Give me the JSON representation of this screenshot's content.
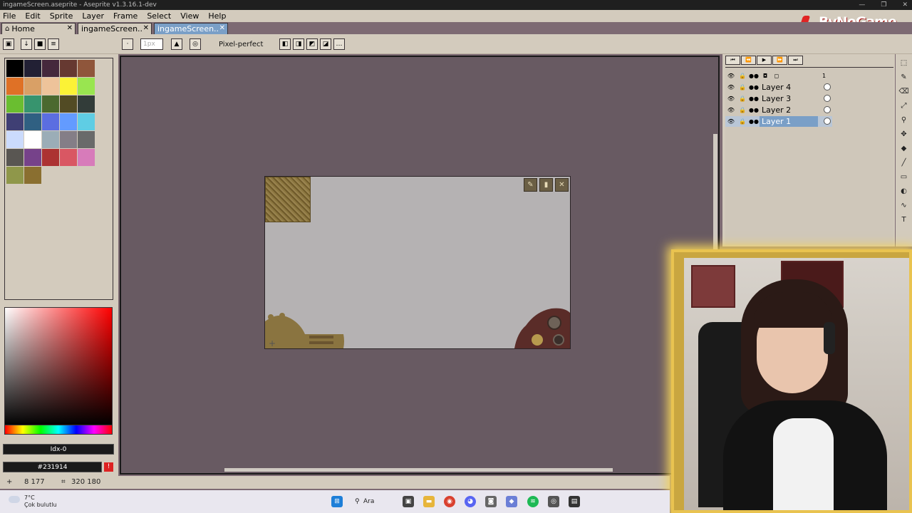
{
  "window": {
    "title": "ingameScreen.aseprite - Aseprite v1.3.16.1-dev",
    "minimize": "—",
    "maximize": "❐",
    "close": "✕"
  },
  "menu": [
    "File",
    "Edit",
    "Sprite",
    "Layer",
    "Frame",
    "Select",
    "View",
    "Help"
  ],
  "tabs": [
    {
      "label": "Home",
      "icon": "home-icon"
    },
    {
      "label": "ingameScreen..",
      "close": "✕"
    },
    {
      "label": "ingameScreen..",
      "close": "✕",
      "active": true
    }
  ],
  "brand": {
    "text": "ByNoGame"
  },
  "toolbar": {
    "brush_size": "1px",
    "pixel_perfect": "Pixel-perfect"
  },
  "palette": {
    "colors": [
      "#000000",
      "#222034",
      "#45283c",
      "#663931",
      "#8f563b",
      "#df7126",
      "#d9a066",
      "#eec39a",
      "#fbf236",
      "#99e550",
      "#6abe30",
      "#37946e",
      "#4b692f",
      "#524b24",
      "#323c39",
      "#3f3f74",
      "#306082",
      "#5b6ee1",
      "#639bff",
      "#5fcde4",
      "#cbdbfc",
      "#ffffff",
      "#9badb7",
      "#847e87",
      "#696a6a",
      "#595652",
      "#76428a",
      "#ac3232",
      "#d95763",
      "#d77bba",
      "#8f974a",
      "#8a6f30"
    ]
  },
  "color": {
    "index": "Idx-0",
    "hex": "#231914",
    "warn": "!"
  },
  "status": {
    "cursor": "8 177",
    "size": "320 180"
  },
  "animation": {
    "buttons": [
      "⏮",
      "⏪",
      "▶",
      "⏩",
      "⏭"
    ]
  },
  "layers": [
    {
      "name": "Layer 4"
    },
    {
      "name": "Layer 3"
    },
    {
      "name": "Layer 2"
    },
    {
      "name": "Layer 1",
      "selected": true
    }
  ],
  "frame_number": "1",
  "taskbar": {
    "weather_temp": "7°C",
    "weather_desc": "Çok bulutlu",
    "search": "Ara"
  }
}
